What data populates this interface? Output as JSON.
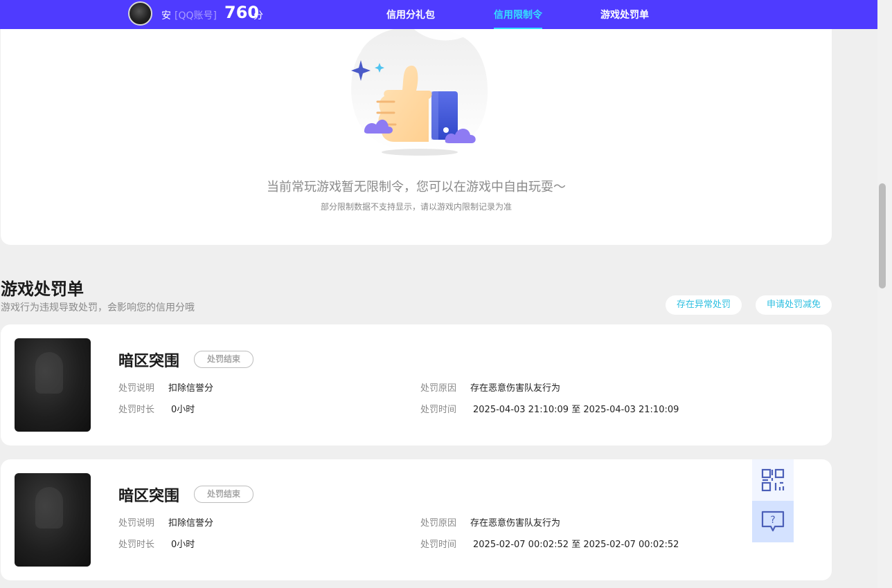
{
  "header": {
    "user_name": "安",
    "account_type": "[QQ账号]",
    "score": "760",
    "score_unit": "分",
    "nav": [
      {
        "label": "信用分礼包",
        "active": false
      },
      {
        "label": "信用限制令",
        "active": true
      },
      {
        "label": "游戏处罚单",
        "active": false
      }
    ]
  },
  "restriction": {
    "empty_title": "当前常玩游戏暂无限制令，您可以在游戏中自由玩耍～",
    "empty_subtitle": "部分限制数据不支持显示，请以游戏内限制记录为准"
  },
  "penalty_section": {
    "title": "游戏处罚单",
    "description": "游戏行为违规导致处罚，会影响您的信用分哦",
    "appeal_abnormal_label": "存在异常处罚",
    "apply_reduction_label": "申请处罚减免",
    "field_labels": {
      "desc": "处罚说明",
      "reason": "处罚原因",
      "duration": "处罚时长",
      "time": "处罚时间"
    },
    "items": [
      {
        "game": "暗区突围",
        "status": "处罚结束",
        "desc": "扣除信誉分",
        "reason": "存在恶意伤害队友行为",
        "duration": "0小时",
        "time": "2025-04-03 21:10:09 至 2025-04-03 21:10:09"
      },
      {
        "game": "暗区突围",
        "status": "处罚结束",
        "desc": "扣除信誉分",
        "reason": "存在恶意伤害队友行为",
        "duration": "0小时",
        "time": "2025-02-07 00:02:52 至 2025-02-07 00:02:52"
      }
    ]
  },
  "floating_tools": {
    "qr_icon": "qr-code-icon",
    "help_icon": "help-chat-icon"
  },
  "colors": {
    "header_bg": "#4f3bff",
    "active_nav": "#35e0ff",
    "pill_text": "#2cbfe0",
    "page_bg": "#efefef"
  }
}
